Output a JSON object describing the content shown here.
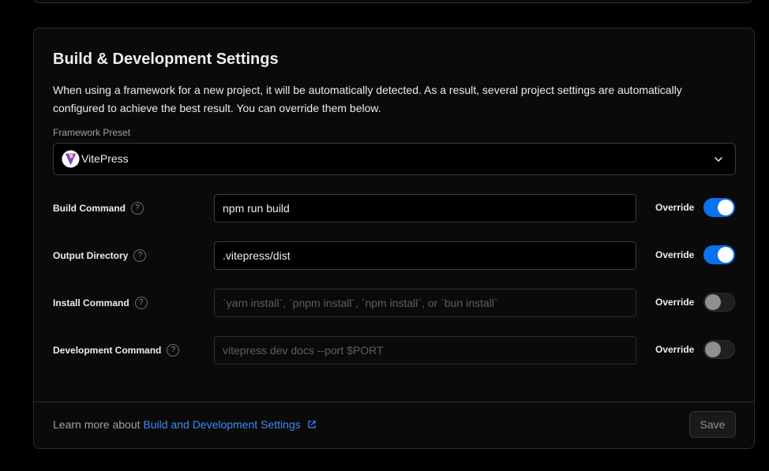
{
  "section": {
    "title": "Build & Development Settings",
    "description": "When using a framework for a new project, it will be automatically detected. As a result, several project settings are automatically configured to achieve the best result. You can override them below."
  },
  "framework_preset": {
    "label": "Framework Preset",
    "value": "VitePress",
    "icon": "vitepress-logo-icon"
  },
  "settings": [
    {
      "label": "Build Command",
      "value": "npm run build",
      "placeholder": "",
      "override_label": "Override",
      "override_on": true
    },
    {
      "label": "Output Directory",
      "value": ".vitepress/dist",
      "placeholder": "",
      "override_label": "Override",
      "override_on": true
    },
    {
      "label": "Install Command",
      "value": "",
      "placeholder": "`yarn install`, `pnpm install`, `npm install`, or `bun install`",
      "override_label": "Override",
      "override_on": false
    },
    {
      "label": "Development Command",
      "value": "",
      "placeholder": "vitepress dev docs --port $PORT",
      "override_label": "Override",
      "override_on": false
    }
  ],
  "footer": {
    "text": "Learn more about",
    "link_text": "Build and Development Settings",
    "save_label": "Save"
  },
  "colors": {
    "background": "#000000",
    "card": "#0a0a0a",
    "accent": "#0a72ef",
    "link": "#3e8bf7"
  }
}
